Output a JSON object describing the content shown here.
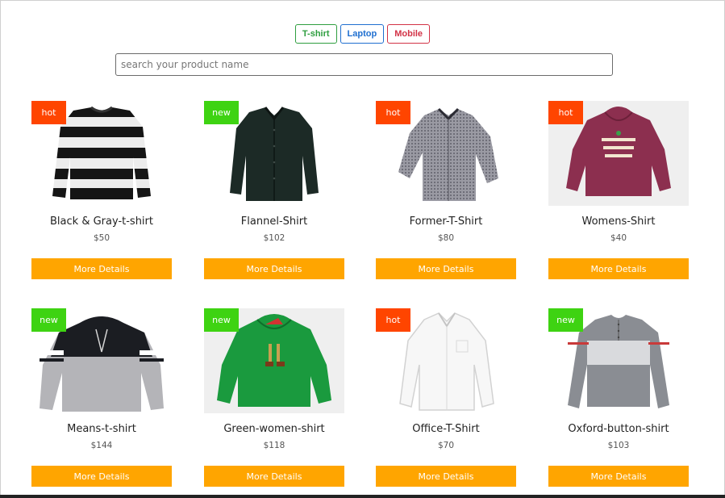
{
  "filters": [
    {
      "label": "T-shirt",
      "color": "#2e9e3f"
    },
    {
      "label": "Laptop",
      "color": "#1f6fd0"
    },
    {
      "label": "Mobile",
      "color": "#d23246"
    }
  ],
  "search": {
    "placeholder": "search your product name",
    "value": ""
  },
  "colors": {
    "hot": "#ff4500",
    "new": "#3ed312",
    "button": "#ffa500"
  },
  "products": [
    {
      "badge": "hot",
      "name": "Black & Gray-t-shirt",
      "price": "$50",
      "button": "More Details",
      "image": "striped-long-sleeve-shirt"
    },
    {
      "badge": "new",
      "name": "Flannel-Shirt",
      "price": "$102",
      "button": "More Details",
      "image": "dark-button-shirt"
    },
    {
      "badge": "hot",
      "name": "Former-T-Shirt",
      "price": "$80",
      "button": "More Details",
      "image": "gray-checked-shirt"
    },
    {
      "badge": "hot",
      "name": "Womens-Shirt",
      "price": "$40",
      "button": "More Details",
      "image": "maroon-hoodie"
    },
    {
      "badge": "new",
      "name": "Means-t-shirt",
      "price": "$144",
      "button": "More Details",
      "image": "black-gray-hoodie"
    },
    {
      "badge": "new",
      "name": "Green-women-shirt",
      "price": "$118",
      "button": "More Details",
      "image": "green-hoodie"
    },
    {
      "badge": "hot",
      "name": "Office-T-Shirt",
      "price": "$70",
      "button": "More Details",
      "image": "white-dress-shirt"
    },
    {
      "badge": "new",
      "name": "Oxford-button-shirt",
      "price": "$103",
      "button": "More Details",
      "image": "gray-henley-shirt"
    }
  ]
}
